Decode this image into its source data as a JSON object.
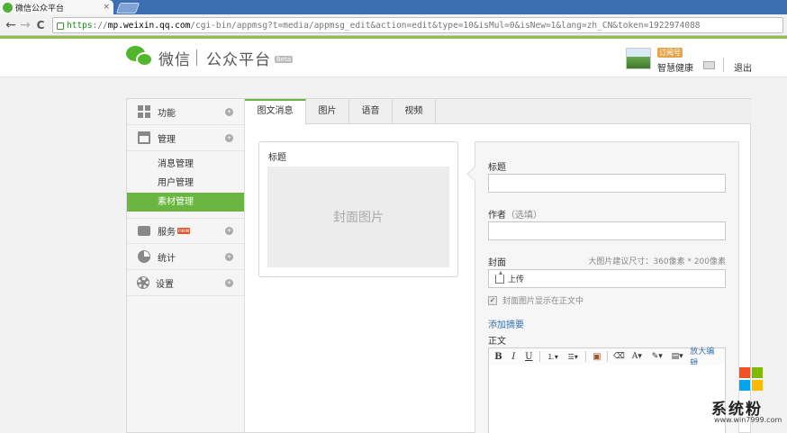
{
  "browser": {
    "tab_title": "微信公众平台",
    "tab_close": "×",
    "url_scheme": "https",
    "url_sep": "://",
    "url_host": "mp.weixin.qq.com",
    "url_path": "/cgi-bin/appmsg?t=media/appmsg_edit&action=edit&type=10&isMul=0&isNew=1&lang=zh_CN&token=1922974088",
    "back": "←",
    "forward": "→",
    "reload": "C"
  },
  "header": {
    "logo_text": "微信",
    "logo_subtitle": "公众平台",
    "beta": "Beta",
    "account_badge": "订阅号",
    "account_name": "智慧健康",
    "logout": "退出"
  },
  "sidebar": {
    "items": [
      {
        "label": "功能",
        "icon": "grid-icon"
      },
      {
        "label": "管理",
        "icon": "tray-icon"
      },
      {
        "label": "服务",
        "icon": "printer-icon",
        "badge": "new"
      },
      {
        "label": "统计",
        "icon": "pie-chart-icon"
      },
      {
        "label": "设置",
        "icon": "gear-icon"
      }
    ],
    "sub_items": [
      "消息管理",
      "用户管理",
      "素材管理"
    ],
    "toggle": "+"
  },
  "tabs": [
    "图文消息",
    "图片",
    "语音",
    "视频"
  ],
  "preview": {
    "title_label": "标题",
    "cover_placeholder": "封面图片"
  },
  "editor": {
    "title_label": "标题",
    "author_label": "作者",
    "author_optional": "（选填）",
    "cover_label": "封面",
    "cover_hint": "大图片建议尺寸：360像素 * 200像素",
    "upload": "上传",
    "show_cover_checkbox": "封面图片显示在正文中",
    "checkbox_mark": "✓",
    "add_summary": "添加摘要",
    "body_label": "正文",
    "toolbar": {
      "bold": "B",
      "italic": "I",
      "underline": "U",
      "ordered_list": "⒈▾",
      "unordered_list": "☰▾",
      "image": "▣",
      "eraser": "⌫",
      "font_color": "A▾",
      "bg_color": "✎▾",
      "more": "▤▾",
      "zoom": "放大编辑"
    }
  },
  "watermark": {
    "text": "系统粉",
    "url": "www.win7999.com"
  },
  "colors": {
    "accent": "#6bb543",
    "link": "#3670b4",
    "tabbar": "#3b6eb3"
  }
}
